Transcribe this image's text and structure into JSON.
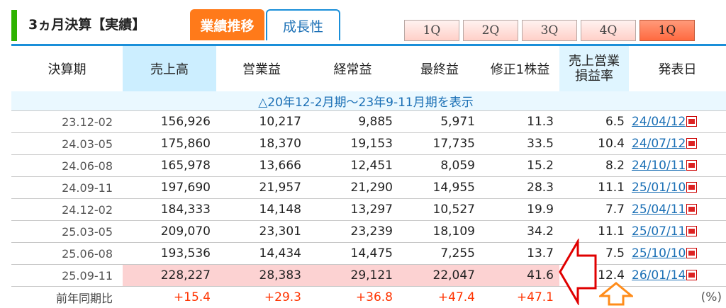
{
  "header": {
    "title": "3ヵ月決算【実績】",
    "tabs": [
      {
        "label": "業績推移",
        "active": true
      },
      {
        "label": "成長性",
        "active": false
      }
    ],
    "quarter_buttons": [
      {
        "label": "1Q",
        "selected": false
      },
      {
        "label": "2Q",
        "selected": false
      },
      {
        "label": "3Q",
        "selected": false
      },
      {
        "label": "4Q",
        "selected": false
      },
      {
        "label": "1Q",
        "selected": true
      }
    ]
  },
  "table": {
    "columns": [
      "決算期",
      "売上高",
      "営業益",
      "経常益",
      "最終益",
      "修正1株益",
      "売上営業",
      "損益率",
      "発表日"
    ],
    "notice": "△20年12-2月期～23年9-11月期を表示",
    "rows": [
      {
        "period": "23.12-02",
        "sales": "156,926",
        "op_income": "10,217",
        "ord_income": "9,885",
        "net_income": "5,971",
        "eps": "11.3",
        "margin": "6.5",
        "date": "24/04/12"
      },
      {
        "period": "24.03-05",
        "sales": "175,860",
        "op_income": "18,370",
        "ord_income": "19,153",
        "net_income": "17,735",
        "eps": "33.5",
        "margin": "10.4",
        "date": "24/07/12"
      },
      {
        "period": "24.06-08",
        "sales": "165,978",
        "op_income": "13,666",
        "ord_income": "12,451",
        "net_income": "8,059",
        "eps": "15.2",
        "margin": "8.2",
        "date": "24/10/11"
      },
      {
        "period": "24.09-11",
        "sales": "197,690",
        "op_income": "21,957",
        "ord_income": "21,290",
        "net_income": "14,955",
        "eps": "28.3",
        "margin": "11.1",
        "date": "25/01/10"
      },
      {
        "period": "24.12-02",
        "sales": "184,333",
        "op_income": "14,148",
        "ord_income": "13,297",
        "net_income": "10,527",
        "eps": "19.9",
        "margin": "7.7",
        "date": "25/04/11"
      },
      {
        "period": "25.03-05",
        "sales": "209,070",
        "op_income": "23,301",
        "ord_income": "23,239",
        "net_income": "18,109",
        "eps": "34.2",
        "margin": "11.1",
        "date": "25/07/11"
      },
      {
        "period": "25.06-08",
        "sales": "193,536",
        "op_income": "14,434",
        "ord_income": "14,475",
        "net_income": "7,255",
        "eps": "13.7",
        "margin": "7.5",
        "date": "25/10/10"
      },
      {
        "period": "25.09-11",
        "sales": "228,227",
        "op_income": "28,383",
        "ord_income": "29,121",
        "net_income": "22,047",
        "eps": "41.6",
        "margin": "12.4",
        "date": "26/01/14"
      }
    ],
    "yoy": {
      "label": "前年同期比",
      "sales": "+15.4",
      "op_income": "+29.3",
      "ord_income": "+36.8",
      "net_income": "+47.4",
      "eps": "+47.1",
      "unit": "(%)"
    }
  },
  "colors": {
    "accent_orange": "#ff7a1a",
    "accent_blue": "#1a8fd9",
    "brand_green": "#2db200",
    "highlight_row": "#fcd2d2",
    "positive_red": "#ff3300"
  }
}
